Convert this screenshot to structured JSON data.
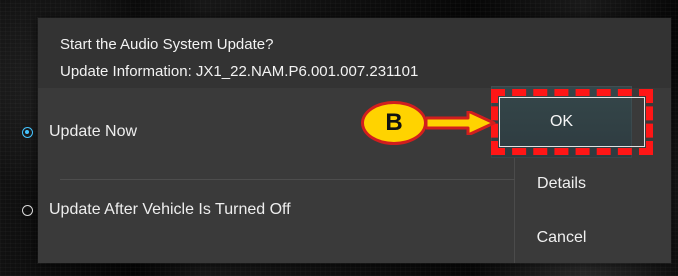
{
  "dialog": {
    "title": "Start the Audio System Update?",
    "update_information": "Update Information: JX1_22.NAM.P6.001.007.231101"
  },
  "options": {
    "update_now": "Update Now",
    "update_after_vehicle_off": "Update After Vehicle Is Turned Off"
  },
  "buttons": {
    "ok": "OK",
    "details": "Details",
    "cancel": "Cancel"
  },
  "callout": {
    "label": "B"
  },
  "icons": {
    "selected_radio": "radio-selected-icon",
    "unselected_radio": "radio-unselected-icon",
    "arrow": "arrow-right-icon"
  },
  "colors": {
    "dialog_background": "#383838",
    "selected_radio": "#45c4ff",
    "highlight": "#ff1616",
    "callout_fill": "#ffd300"
  }
}
